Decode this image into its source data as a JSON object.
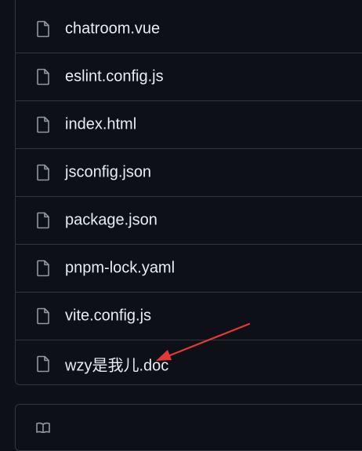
{
  "files": [
    {
      "name": "chatroom.vue",
      "icon": "file-icon"
    },
    {
      "name": "eslint.config.js",
      "icon": "file-icon"
    },
    {
      "name": "index.html",
      "icon": "file-icon"
    },
    {
      "name": "jsconfig.json",
      "icon": "file-icon"
    },
    {
      "name": "package.json",
      "icon": "file-icon"
    },
    {
      "name": "pnpm-lock.yaml",
      "icon": "file-icon"
    },
    {
      "name": "vite.config.js",
      "icon": "file-icon"
    },
    {
      "name": "wzy是我儿.doc",
      "icon": "file-icon"
    }
  ],
  "colors": {
    "background": "#0d1117",
    "border": "#30363d",
    "text": "#e6edf3",
    "icon": "#9198a1",
    "annotation_arrow": "#e5383b"
  },
  "readme_icon": "book-icon"
}
